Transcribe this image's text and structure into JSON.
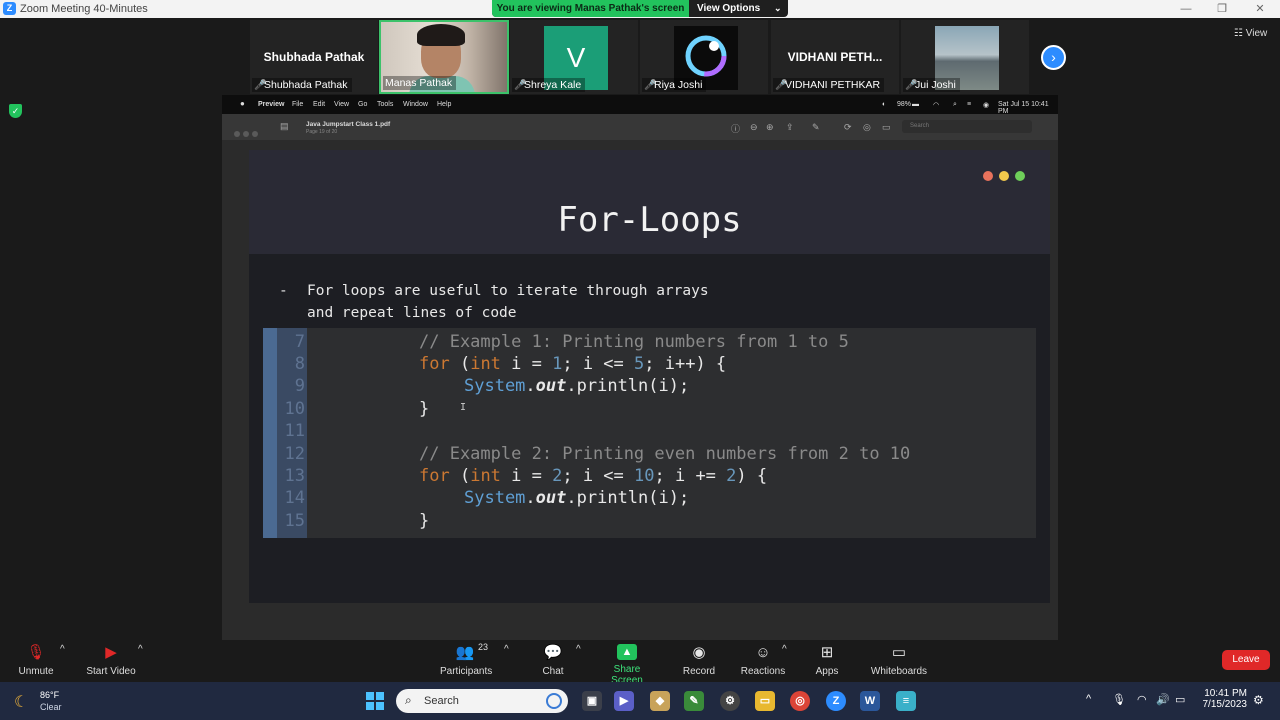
{
  "window": {
    "title": "Zoom Meeting 40-Minutes",
    "logo_letter": "Z",
    "minimize": "—",
    "maximize": "❐",
    "close": "✕"
  },
  "banner": {
    "viewing": "You are viewing Manas Pathak's screen",
    "view_options": "View Options",
    "chevron": "⌄"
  },
  "gallery": {
    "view_label": "☷ View",
    "next": "›",
    "participants": [
      {
        "big_name": "Shubhada Pathak",
        "name": "Shubhada Pathak",
        "muted": true
      },
      {
        "name": "Manas Pathak",
        "muted": false
      },
      {
        "avatar": "V",
        "name": "Shreya Kale",
        "muted": true
      },
      {
        "name": "Riya Joshi",
        "muted": true
      },
      {
        "big_name": "VIDHANI PETH...",
        "name": "VIDHANI PETHKAR",
        "muted": true
      },
      {
        "name": "Jui Joshi",
        "muted": true
      }
    ]
  },
  "shared_screen": {
    "menubar": {
      "apple": "",
      "app": "Preview",
      "items": [
        "File",
        "Edit",
        "View",
        "Go",
        "Tools",
        "Window",
        "Help"
      ],
      "battery": "98%",
      "datetime": "Sat Jul 15  10:41 PM"
    },
    "preview": {
      "document": "Java Jumpstart Class 1.pdf",
      "page": "Page 19 of 20",
      "search_placeholder": "Search"
    },
    "slide": {
      "title": "For-Loops",
      "bullet_dash": "-",
      "bullet_text": "For loops are useful to iterate through arrays and repeat lines of code",
      "dot_colors": [
        "#e8725c",
        "#f2c94c",
        "#6fcf5a"
      ],
      "code": {
        "line_numbers": [
          "7",
          "8",
          "9",
          "10",
          "11",
          "12",
          "13",
          "14",
          "15"
        ],
        "lines": [
          {
            "comment": "// Example 1: Printing numbers from 1 to 5"
          },
          {
            "kw": "for",
            "p1": " (",
            "t": "int",
            "p2": " i = ",
            "n1": "1",
            "p3": "; i <= ",
            "n2": "5",
            "p4": "; i++) {"
          },
          {
            "sys": "System",
            "dot": ".",
            "out": "out",
            "rest": ".println(i);"
          },
          {
            "brace": "}"
          },
          {
            "comment": "// Example 2: Printing even numbers from 2 to 10"
          },
          {
            "kw": "for",
            "p1": " (",
            "t": "int",
            "p2": " i = ",
            "n1": "2",
            "p3": "; i <= ",
            "n2": "10",
            "p4": "; i += ",
            "n3": "2",
            "p5": ") {"
          },
          {
            "sys": "System",
            "dot": ".",
            "out": "out",
            "rest": ".println(i);"
          },
          {
            "brace": "}"
          }
        ],
        "cursor": "I"
      }
    }
  },
  "toolbar": {
    "unmute": "Unmute",
    "start_video": "Start Video",
    "participants": "Participants",
    "participants_count": "23",
    "chat": "Chat",
    "share_screen": "Share Screen",
    "record": "Record",
    "reactions": "Reactions",
    "apps": "Apps",
    "whiteboards": "Whiteboards",
    "leave": "Leave"
  },
  "taskbar": {
    "temperature": "86°F",
    "condition": "Clear",
    "search_placeholder": "Search",
    "time": "10:41 PM",
    "date": "7/15/2023"
  }
}
